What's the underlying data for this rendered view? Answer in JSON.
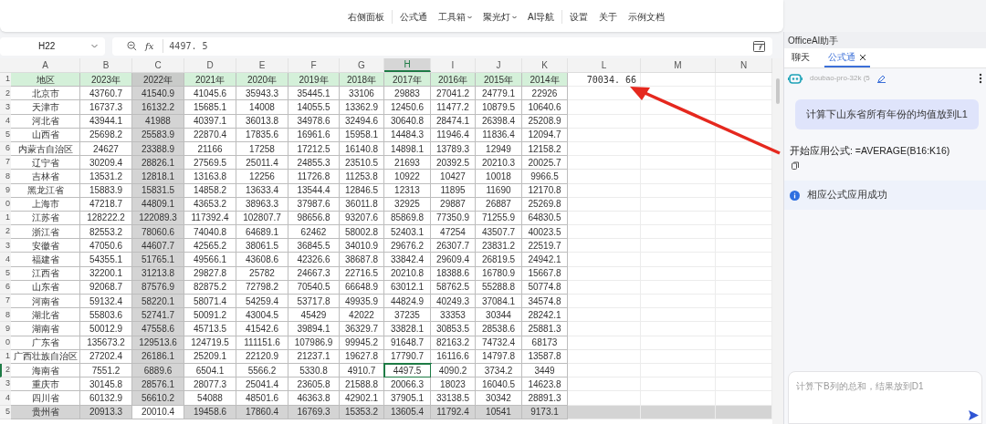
{
  "toolbar": {
    "groups": [
      [
        "右侧面板"
      ],
      [
        {
          "label": "公式通",
          "dropdown": false
        },
        {
          "label": "工具箱",
          "dropdown": true
        },
        {
          "label": "聚光灯",
          "dropdown": true
        },
        {
          "label": "AI导航",
          "dropdown": false
        }
      ],
      [
        "设置",
        "关于",
        "示例文档"
      ]
    ]
  },
  "formula_bar": {
    "cell_ref": "H22",
    "function_label": "fx",
    "value": "4497. 5"
  },
  "sheet": {
    "columns": [
      {
        "label": "A",
        "kind": "table",
        "shaded": false,
        "active": false
      },
      {
        "label": "B",
        "kind": "table",
        "shaded": false,
        "active": false
      },
      {
        "label": "C",
        "kind": "table",
        "shaded": true,
        "active": false
      },
      {
        "label": "D",
        "kind": "table",
        "shaded": false,
        "active": false
      },
      {
        "label": "E",
        "kind": "table",
        "shaded": false,
        "active": false
      },
      {
        "label": "F",
        "kind": "table",
        "shaded": false,
        "active": false
      },
      {
        "label": "G",
        "kind": "table",
        "shaded": false,
        "active": false
      },
      {
        "label": "H",
        "kind": "table",
        "shaded": false,
        "active": true
      },
      {
        "label": "I",
        "kind": "table",
        "shaded": false,
        "active": false
      },
      {
        "label": "J",
        "kind": "table",
        "shaded": false,
        "active": false
      },
      {
        "label": "K",
        "kind": "table",
        "shaded": false,
        "active": false
      },
      {
        "label": "L",
        "kind": "sheet",
        "shaded": false,
        "active": false
      },
      {
        "label": "M",
        "kind": "sheet",
        "shaded": false,
        "active": false
      },
      {
        "label": "N",
        "kind": "sheet",
        "shaded": false,
        "active": false
      }
    ],
    "rows": [
      {
        "number": "1",
        "kind": "header",
        "shaded": false,
        "active": false,
        "cells": [
          "地区",
          "2023年",
          "2022年",
          "2021年",
          "2020年",
          "2019年",
          "2018年",
          "2017年",
          "2016年",
          "2015年",
          "2014年",
          "70034. 66"
        ]
      },
      {
        "number": "2",
        "kind": "data",
        "shaded": false,
        "active": false,
        "cells": [
          "北京市",
          "43760.7",
          "41540.9",
          "41045.6",
          "35943.3",
          "35445.1",
          "33106",
          "29883",
          "27041.2",
          "24779.1",
          "22926"
        ]
      },
      {
        "number": "3",
        "kind": "data",
        "shaded": false,
        "active": false,
        "cells": [
          "天津市",
          "16737.3",
          "16132.2",
          "15685.1",
          "14008",
          "14055.5",
          "13362.9",
          "12450.6",
          "11477.2",
          "10879.5",
          "10640.6"
        ]
      },
      {
        "number": "4",
        "kind": "data",
        "shaded": false,
        "active": false,
        "cells": [
          "河北省",
          "43944.1",
          "41988",
          "40397.1",
          "36013.8",
          "34978.6",
          "32494.6",
          "30640.8",
          "28474.1",
          "26398.4",
          "25208.9"
        ]
      },
      {
        "number": "5",
        "kind": "data",
        "shaded": false,
        "active": false,
        "cells": [
          "山西省",
          "25698.2",
          "25583.9",
          "22870.4",
          "17835.6",
          "16961.6",
          "15958.1",
          "14484.3",
          "11946.4",
          "11836.4",
          "12094.7"
        ]
      },
      {
        "number": "6",
        "kind": "data",
        "shaded": false,
        "active": false,
        "cells": [
          "内蒙古自治区",
          "24627",
          "23388.9",
          "21166",
          "17258",
          "17212.5",
          "16140.8",
          "14898.1",
          "13789.3",
          "12949",
          "12158.2"
        ]
      },
      {
        "number": "7",
        "kind": "data",
        "shaded": false,
        "active": false,
        "cells": [
          "辽宁省",
          "30209.4",
          "28826.1",
          "27569.5",
          "25011.4",
          "24855.3",
          "23510.5",
          "21693",
          "20392.5",
          "20210.3",
          "20025.7"
        ]
      },
      {
        "number": "8",
        "kind": "data",
        "shaded": false,
        "active": false,
        "cells": [
          "吉林省",
          "13531.2",
          "12818.1",
          "13163.8",
          "12256",
          "11726.8",
          "11253.8",
          "10922",
          "10427",
          "10018",
          "9966.5"
        ]
      },
      {
        "number": "9",
        "kind": "data",
        "shaded": false,
        "active": false,
        "cells": [
          "黑龙江省",
          "15883.9",
          "15831.5",
          "14858.2",
          "13633.4",
          "13544.4",
          "12846.5",
          "12313",
          "11895",
          "11690",
          "12170.8"
        ]
      },
      {
        "number": "0",
        "kind": "data",
        "shaded": false,
        "active": false,
        "cells": [
          "上海市",
          "47218.7",
          "44809.1",
          "43653.2",
          "38963.3",
          "37987.6",
          "36011.8",
          "32925",
          "29887",
          "26887",
          "25269.8"
        ]
      },
      {
        "number": "1",
        "kind": "data",
        "shaded": false,
        "active": false,
        "cells": [
          "江苏省",
          "128222.2",
          "122089.3",
          "117392.4",
          "102807.7",
          "98656.8",
          "93207.6",
          "85869.8",
          "77350.9",
          "71255.9",
          "64830.5"
        ]
      },
      {
        "number": "2",
        "kind": "data",
        "shaded": false,
        "active": false,
        "cells": [
          "浙江省",
          "82553.2",
          "78060.6",
          "74040.8",
          "64689.1",
          "62462",
          "58002.8",
          "52403.1",
          "47254",
          "43507.7",
          "40023.5"
        ]
      },
      {
        "number": "3",
        "kind": "data",
        "shaded": false,
        "active": false,
        "cells": [
          "安徽省",
          "47050.6",
          "44607.7",
          "42565.2",
          "38061.5",
          "36845.5",
          "34010.9",
          "29676.2",
          "26307.7",
          "23831.2",
          "22519.7"
        ]
      },
      {
        "number": "4",
        "kind": "data",
        "shaded": false,
        "active": false,
        "cells": [
          "福建省",
          "54355.1",
          "51765.1",
          "49566.1",
          "43608.6",
          "42326.6",
          "38687.8",
          "33842.4",
          "29609.4",
          "26819.5",
          "24942.1"
        ]
      },
      {
        "number": "5",
        "kind": "data",
        "shaded": false,
        "active": false,
        "cells": [
          "江西省",
          "32200.1",
          "31213.8",
          "29827.8",
          "25782",
          "24667.3",
          "22716.5",
          "20210.8",
          "18388.6",
          "16780.9",
          "15667.8"
        ]
      },
      {
        "number": "6",
        "kind": "data",
        "shaded": false,
        "active": false,
        "cells": [
          "山东省",
          "92068.7",
          "87576.9",
          "82875.2",
          "72798.2",
          "70540.5",
          "66648.9",
          "63012.1",
          "58762.5",
          "55288.8",
          "50774.8"
        ]
      },
      {
        "number": "7",
        "kind": "data",
        "shaded": false,
        "active": false,
        "cells": [
          "河南省",
          "59132.4",
          "58220.1",
          "58071.4",
          "54259.4",
          "53717.8",
          "49935.9",
          "44824.9",
          "40249.3",
          "37084.1",
          "34574.8"
        ]
      },
      {
        "number": "8",
        "kind": "data",
        "shaded": false,
        "active": false,
        "cells": [
          "湖北省",
          "55803.6",
          "52741.7",
          "50091.2",
          "43004.5",
          "45429",
          "42022",
          "37235",
          "33353",
          "30344",
          "28242.1"
        ]
      },
      {
        "number": "9",
        "kind": "data",
        "shaded": false,
        "active": false,
        "cells": [
          "湖南省",
          "50012.9",
          "47558.6",
          "45713.5",
          "41542.6",
          "39894.1",
          "36329.7",
          "33828.1",
          "30853.5",
          "28538.6",
          "25881.3"
        ]
      },
      {
        "number": "0",
        "kind": "data",
        "shaded": false,
        "active": false,
        "cells": [
          "广东省",
          "135673.2",
          "129513.6",
          "124719.5",
          "111151.6",
          "107986.9",
          "99945.2",
          "91648.7",
          "82163.2",
          "74732.4",
          "68173"
        ]
      },
      {
        "number": "1",
        "kind": "data",
        "shaded": false,
        "active": false,
        "cells": [
          "广西壮族自治区",
          "27202.4",
          "26186.1",
          "25209.1",
          "22120.9",
          "21237.1",
          "19627.8",
          "17790.7",
          "16116.6",
          "14797.8",
          "13587.8"
        ]
      },
      {
        "number": "2",
        "kind": "data",
        "shaded": false,
        "active": true,
        "cells": [
          "海南省",
          "7551.2",
          "6889.6",
          "6504.1",
          "5566.2",
          "5330.8",
          "4910.7",
          "4497.5",
          "4090.2",
          "3734.2",
          "3449"
        ]
      },
      {
        "number": "3",
        "kind": "data",
        "shaded": false,
        "active": false,
        "cells": [
          "重庆市",
          "30145.8",
          "28576.1",
          "28077.3",
          "25041.4",
          "23605.8",
          "21588.8",
          "20066.3",
          "18023",
          "16040.5",
          "14623.8"
        ]
      },
      {
        "number": "4",
        "kind": "data",
        "shaded": false,
        "active": false,
        "cells": [
          "四川省",
          "60132.9",
          "56610.2",
          "54088",
          "48501.6",
          "46363.8",
          "42902.1",
          "37905.1",
          "33138.5",
          "30342",
          "28891.3"
        ]
      },
      {
        "number": "5",
        "kind": "data",
        "shaded": true,
        "active": false,
        "cells": [
          "贵州省",
          "20913.3",
          "20010.4",
          "19458.6",
          "17860.4",
          "16769.3",
          "15353.2",
          "13605.4",
          "11792.4",
          "10541",
          "9173.1"
        ]
      }
    ]
  },
  "assistant": {
    "title": "OfficeAI助手",
    "tabs": [
      {
        "label": "聊天",
        "selected": false,
        "closable": false
      },
      {
        "label": "公式通",
        "selected": true,
        "closable": true
      }
    ],
    "model": "doubao-pro-32k (5",
    "messages": [
      {
        "kind": "user",
        "text": "计算下山东省所有年份的均值放到L1"
      },
      {
        "kind": "reply",
        "text": "开始应用公式: =AVERAGE(B16:K16)"
      },
      {
        "kind": "info",
        "text": "相应公式应用成功"
      }
    ],
    "input": {
      "placeholder": "计算下B列的总和，结果放到D1"
    }
  }
}
